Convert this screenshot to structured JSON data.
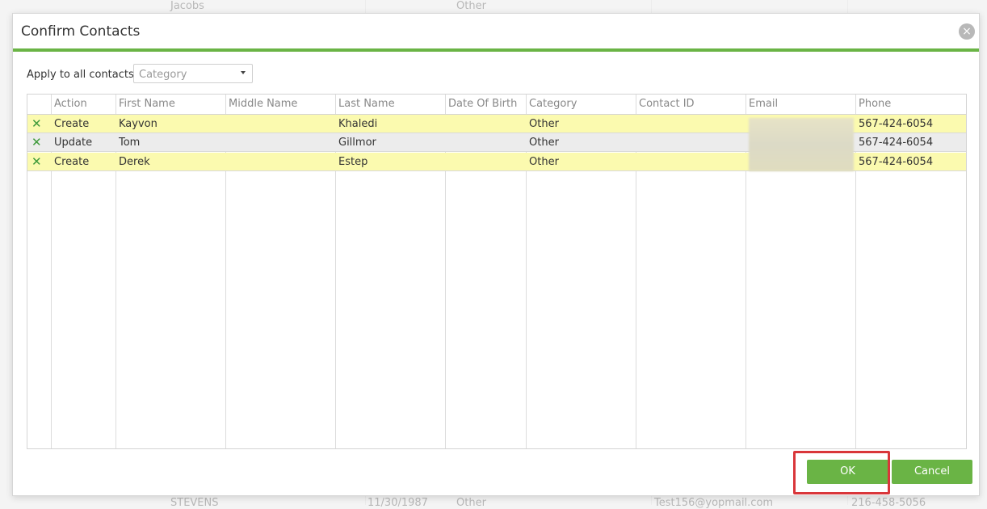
{
  "background": {
    "top_row": {
      "last_name": "Jacobs",
      "category": "Other"
    },
    "bottom_row": {
      "last_name": "STEVENS",
      "dob": "11/30/1987",
      "category": "Other",
      "email": "Test156@yopmail.com",
      "phone": "216-458-5056"
    }
  },
  "dialog": {
    "title": "Confirm Contacts",
    "close_glyph": "×",
    "apply_label": "Apply to all contacts:",
    "category_placeholder": "Category",
    "columns": [
      "Action",
      "First Name",
      "Middle Name",
      "Last Name",
      "Date Of Birth",
      "Category",
      "Contact ID",
      "Email",
      "Phone"
    ],
    "rows": [
      {
        "action": "Create",
        "first_name": "Kayvon",
        "middle_name": "",
        "last_name": "Khaledi",
        "dob": "",
        "category": "Other",
        "contact_id": "",
        "email": "",
        "phone": "567-424-6054",
        "highlight": "yellow"
      },
      {
        "action": "Update",
        "first_name": "Tom",
        "middle_name": "",
        "last_name": "Gillmor",
        "dob": "",
        "category": "Other",
        "contact_id": "",
        "email": "",
        "phone": "567-424-6054",
        "highlight": "grey"
      },
      {
        "action": "Create",
        "first_name": "Derek",
        "middle_name": "",
        "last_name": "Estep",
        "dob": "",
        "category": "Other",
        "contact_id": "",
        "email": "",
        "phone": "567-424-6054",
        "highlight": "yellow"
      }
    ],
    "remove_glyph": "✕",
    "ok_label": "OK",
    "cancel_label": "Cancel"
  },
  "colors": {
    "accent": "#6ab445",
    "highlight_row": "#fbfaaf",
    "alt_row": "#ececec",
    "annotation": "#d9363a"
  }
}
